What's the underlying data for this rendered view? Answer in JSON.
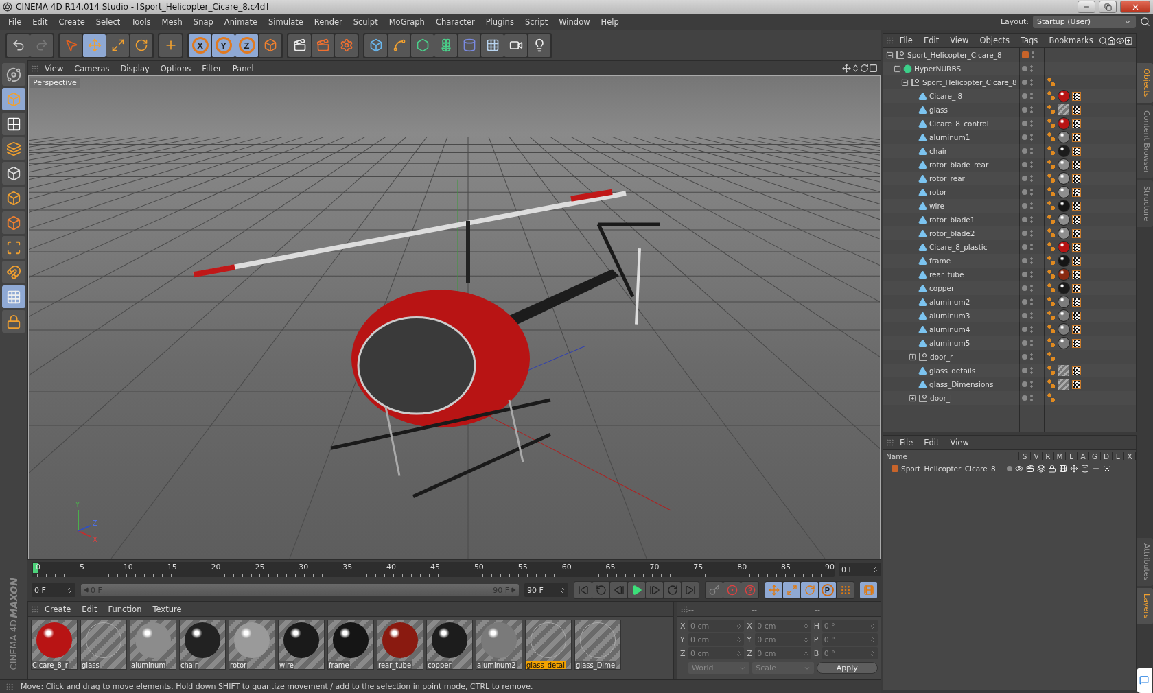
{
  "window": {
    "title": "CINEMA 4D R14.014 Studio - [Sport_Helicopter_Cicare_8.c4d]"
  },
  "menu": [
    "File",
    "Edit",
    "Create",
    "Select",
    "Tools",
    "Mesh",
    "Snap",
    "Animate",
    "Simulate",
    "Render",
    "Sculpt",
    "MoGraph",
    "Character",
    "Plugins",
    "Script",
    "Window",
    "Help"
  ],
  "layout": {
    "label": "Layout:",
    "value": "Startup (User)"
  },
  "toolbar": [
    [
      {
        "kind": "undo",
        "selected": false
      },
      {
        "kind": "redo",
        "selected": false
      }
    ],
    [
      {
        "kind": "select",
        "selected": false
      },
      {
        "kind": "move",
        "selected": true
      },
      {
        "kind": "scale",
        "selected": false
      },
      {
        "kind": "rotate",
        "selected": false
      }
    ],
    [
      {
        "kind": "last-tool",
        "selected": false
      }
    ],
    [
      {
        "kind": "axis",
        "label": "X",
        "selected": true
      },
      {
        "kind": "axis",
        "label": "Y",
        "selected": true
      },
      {
        "kind": "axis",
        "label": "Z",
        "selected": true
      },
      {
        "kind": "coord-system",
        "selected": false
      }
    ],
    [
      {
        "kind": "render-view",
        "selected": false
      },
      {
        "kind": "render-picture",
        "selected": false
      },
      {
        "kind": "render-settings",
        "selected": false
      }
    ],
    [
      {
        "kind": "cube",
        "selected": false
      },
      {
        "kind": "spline",
        "selected": false
      },
      {
        "kind": "nurbs",
        "selected": false
      },
      {
        "kind": "array",
        "selected": false
      },
      {
        "kind": "deformer",
        "selected": false
      },
      {
        "kind": "floor",
        "selected": false
      },
      {
        "kind": "camera",
        "selected": false
      },
      {
        "kind": "light",
        "selected": false
      }
    ]
  ],
  "left_tools": [
    {
      "kind": "model",
      "selected": false
    },
    {
      "kind": "object",
      "selected": true
    },
    {
      "kind": "texture",
      "selected": false
    },
    {
      "kind": "workplane",
      "selected": false
    },
    {
      "kind": "points",
      "selected": false
    },
    {
      "kind": "edges",
      "selected": false
    },
    {
      "kind": "polygons",
      "selected": false
    },
    {
      "kind": "axis",
      "selected": false
    },
    {
      "kind": "tweak",
      "selected": false
    },
    {
      "kind": "snap",
      "selected": true
    },
    {
      "kind": "lock",
      "selected": false
    }
  ],
  "logo": {
    "brand": "MAXON",
    "product": "CINEMA 4D"
  },
  "viewport": {
    "menu": [
      "View",
      "Cameras",
      "Display",
      "Options",
      "Filter",
      "Panel"
    ],
    "camera": "Perspective",
    "axis_labels": [
      "Y",
      "Z",
      "X"
    ]
  },
  "objects": {
    "menu": [
      "File",
      "Edit",
      "View",
      "Objects",
      "Tags",
      "Bookmarks"
    ],
    "tree": [
      {
        "name": "Sport_Helicopter_Cicare_8",
        "kind": "null",
        "expanded": true,
        "color": "#c8642a",
        "phong": false,
        "children": [
          {
            "name": "HyperNURBS",
            "kind": "nurbs",
            "expanded": true,
            "phong": false,
            "children": [
              {
                "name": "Sport_Helicopter_Cicare_8",
                "kind": "null",
                "expanded": true,
                "phong": true,
                "children": [
                  {
                    "name": "Cicare_ 8",
                    "kind": "polygon",
                    "phong": true,
                    "material": {
                      "kind": "sphere",
                      "color": "#b81414"
                    }
                  },
                  {
                    "name": "glass",
                    "kind": "polygon",
                    "phong": true,
                    "material": {
                      "kind": "glass"
                    }
                  },
                  {
                    "name": "Cicare_8_control",
                    "kind": "polygon",
                    "phong": true,
                    "material": {
                      "kind": "sphere",
                      "color": "#b81414"
                    }
                  },
                  {
                    "name": "aluminum1",
                    "kind": "polygon",
                    "phong": true,
                    "material": {
                      "kind": "sphere",
                      "color": "#7c7c7c"
                    }
                  },
                  {
                    "name": "chair",
                    "kind": "polygon",
                    "phong": true,
                    "material": {
                      "kind": "sphere",
                      "color": "#1c1c1c"
                    }
                  },
                  {
                    "name": "rotor_blade_rear",
                    "kind": "polygon",
                    "phong": true,
                    "material": {
                      "kind": "sphere",
                      "color": "#8e8e8e"
                    }
                  },
                  {
                    "name": "rotor_rear",
                    "kind": "polygon",
                    "phong": true,
                    "material": {
                      "kind": "sphere",
                      "color": "#8e8e8e"
                    }
                  },
                  {
                    "name": "rotor",
                    "kind": "polygon",
                    "phong": true,
                    "material": {
                      "kind": "sphere",
                      "color": "#8e8e8e"
                    }
                  },
                  {
                    "name": "wire",
                    "kind": "polygon",
                    "phong": true,
                    "material": {
                      "kind": "sphere",
                      "color": "#151515"
                    }
                  },
                  {
                    "name": "rotor_blade1",
                    "kind": "polygon",
                    "phong": true,
                    "material": {
                      "kind": "sphere",
                      "color": "#8e8e8e"
                    }
                  },
                  {
                    "name": "rotor_blade2",
                    "kind": "polygon",
                    "phong": true,
                    "material": {
                      "kind": "sphere",
                      "color": "#8e8e8e"
                    }
                  },
                  {
                    "name": "Cicare_8_plastic",
                    "kind": "polygon",
                    "phong": true,
                    "material": {
                      "kind": "sphere",
                      "color": "#b81414"
                    }
                  },
                  {
                    "name": "frame",
                    "kind": "polygon",
                    "phong": true,
                    "material": {
                      "kind": "sphere",
                      "color": "#151515"
                    }
                  },
                  {
                    "name": "rear_tube",
                    "kind": "polygon",
                    "phong": true,
                    "material": {
                      "kind": "sphere",
                      "color": "#8a2a10"
                    }
                  },
                  {
                    "name": "copper",
                    "kind": "polygon",
                    "phong": true,
                    "material": {
                      "kind": "sphere",
                      "color": "#1c1c1c"
                    }
                  },
                  {
                    "name": "aluminum2",
                    "kind": "polygon",
                    "phong": true,
                    "material": {
                      "kind": "sphere",
                      "color": "#7c7c7c"
                    }
                  },
                  {
                    "name": "aluminum3",
                    "kind": "polygon",
                    "phong": true,
                    "material": {
                      "kind": "sphere",
                      "color": "#7c7c7c"
                    }
                  },
                  {
                    "name": "aluminum4",
                    "kind": "polygon",
                    "phong": true,
                    "material": {
                      "kind": "sphere",
                      "color": "#7c7c7c"
                    }
                  },
                  {
                    "name": "aluminum5",
                    "kind": "polygon",
                    "phong": true,
                    "material": {
                      "kind": "sphere",
                      "color": "#7c7c7c"
                    }
                  },
                  {
                    "name": "door_r",
                    "kind": "null",
                    "expanded": false,
                    "phong": true
                  },
                  {
                    "name": "glass_details",
                    "kind": "polygon",
                    "phong": true,
                    "material": {
                      "kind": "glass"
                    }
                  },
                  {
                    "name": "glass_Dimensions",
                    "kind": "polygon",
                    "phong": true,
                    "material": {
                      "kind": "glass"
                    }
                  },
                  {
                    "name": "door_l",
                    "kind": "null",
                    "expanded": false,
                    "phong": true
                  }
                ]
              }
            ]
          }
        ]
      }
    ]
  },
  "layers": {
    "menu": [
      "File",
      "Edit",
      "View"
    ],
    "columns": [
      "Name",
      "S",
      "V",
      "R",
      "M",
      "L",
      "A",
      "G",
      "D",
      "E",
      "X"
    ],
    "rows": [
      {
        "name": "Sport_Helicopter_Cicare_8",
        "color": "#c8642a"
      }
    ]
  },
  "side_tabs": {
    "top": [
      {
        "label": "Objects",
        "selected": true
      },
      {
        "label": "Content Browser",
        "selected": false
      },
      {
        "label": "Structure",
        "selected": false
      }
    ],
    "bottom": [
      {
        "label": "Attributes",
        "selected": false
      },
      {
        "label": "Layers",
        "selected": true
      }
    ]
  },
  "timeline": {
    "ruler": [
      "0",
      "5",
      "10",
      "15",
      "20",
      "25",
      "30",
      "35",
      "40",
      "45",
      "50",
      "55",
      "60",
      "65",
      "70",
      "75",
      "80",
      "85",
      "90"
    ],
    "playhead": {
      "level": 0
    },
    "current_frame": "0 F",
    "start": "0 F",
    "range": {
      "start": "0 F",
      "end": "90 F",
      "level": 1
    },
    "end": "90 F",
    "playback": [
      {
        "kind": "first"
      },
      {
        "kind": "prev-key"
      },
      {
        "kind": "prev-frame"
      },
      {
        "kind": "play"
      },
      {
        "kind": "next-frame"
      },
      {
        "kind": "next-key"
      },
      {
        "kind": "last"
      }
    ],
    "keys": [
      {
        "kind": "record"
      },
      {
        "kind": "auto-key"
      },
      {
        "kind": "key-help"
      }
    ],
    "modes": [
      {
        "kind": "move",
        "selected": true
      },
      {
        "kind": "scale",
        "selected": true
      },
      {
        "kind": "rotate",
        "selected": true
      },
      {
        "kind": "param",
        "label": "P",
        "selected": true
      },
      {
        "kind": "points",
        "selected": false
      }
    ],
    "film_selected": true
  },
  "materials": {
    "menu": [
      "Create",
      "Edit",
      "Function",
      "Texture"
    ],
    "items": [
      {
        "name": "Cicare_8_r",
        "kind": "sphere",
        "color": "#b81414",
        "selected": false
      },
      {
        "name": "glass",
        "kind": "glass",
        "selected": false
      },
      {
        "name": "aluminum",
        "kind": "sphere",
        "color": "#8c8c8c",
        "selected": false
      },
      {
        "name": "chair",
        "kind": "sphere",
        "color": "#222222",
        "selected": false
      },
      {
        "name": "rotor",
        "kind": "sphere",
        "color": "#9a9a9a",
        "selected": false
      },
      {
        "name": "wire",
        "kind": "sphere",
        "color": "#1a1a1a",
        "selected": false
      },
      {
        "name": "frame",
        "kind": "sphere",
        "color": "#151515",
        "selected": false
      },
      {
        "name": "rear_tube",
        "kind": "sphere",
        "color": "#8a1a10",
        "selected": false
      },
      {
        "name": "copper",
        "kind": "sphere",
        "color": "#1c1c1c",
        "selected": false
      },
      {
        "name": "aluminum2",
        "kind": "sphere",
        "color": "#7a7a7a",
        "selected": false
      },
      {
        "name": "glass_detai",
        "kind": "glass",
        "selected": true
      },
      {
        "name": "glass_Dime",
        "kind": "glass",
        "selected": false
      }
    ]
  },
  "coordinates": {
    "headers": [
      "--",
      "--",
      "--"
    ],
    "columns": [
      [
        {
          "label": "X",
          "value": "0 cm"
        },
        {
          "label": "Y",
          "value": "0 cm"
        },
        {
          "label": "Z",
          "value": "0 cm"
        }
      ],
      [
        {
          "label": "X",
          "value": "0 cm"
        },
        {
          "label": "Y",
          "value": "0 cm"
        },
        {
          "label": "Z",
          "value": "0 cm"
        }
      ],
      [
        {
          "label": "H",
          "value": "0 °"
        },
        {
          "label": "P",
          "value": "0 °"
        },
        {
          "label": "B",
          "value": "0 °"
        }
      ]
    ],
    "dropdowns": [
      "World",
      "Scale"
    ],
    "apply": "Apply"
  },
  "status_bar": "Move: Click and drag to move elements. Hold down SHIFT to quantize movement / add to the selection in point mode, CTRL to remove."
}
